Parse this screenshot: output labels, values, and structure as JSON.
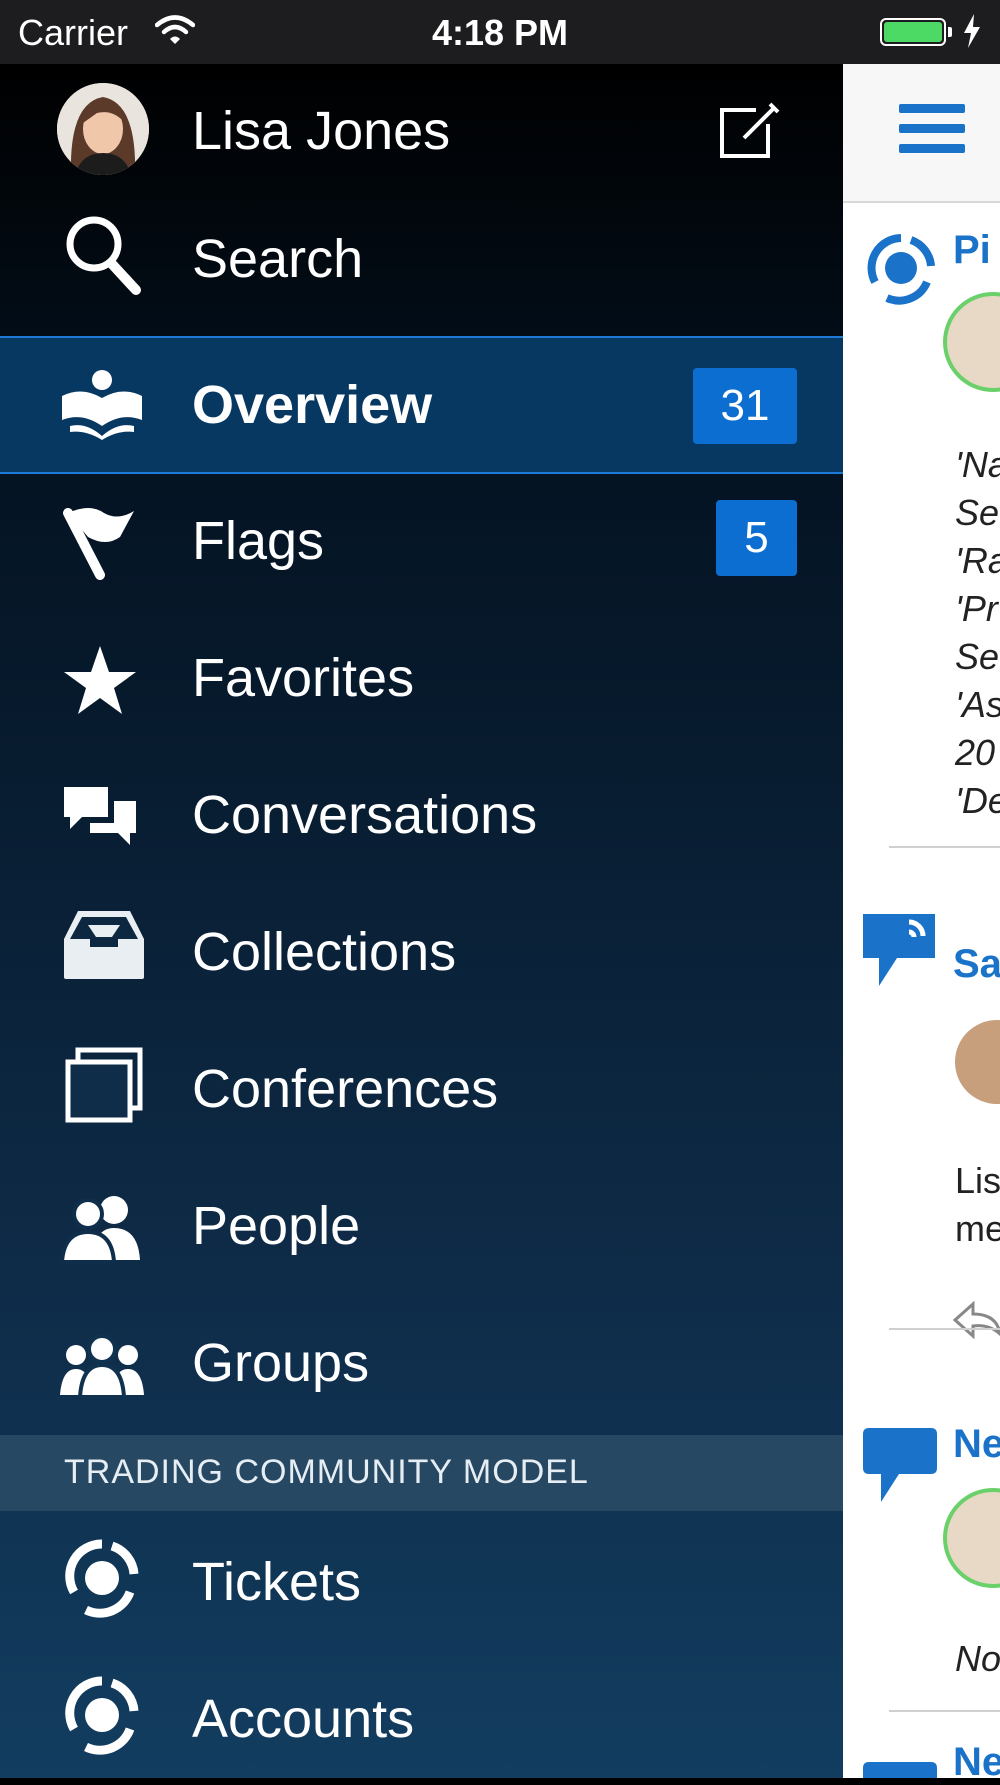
{
  "status_bar": {
    "carrier": "Carrier",
    "time": "4:18 PM",
    "battery_color": "#4cd964"
  },
  "drawer": {
    "user_name": "Lisa Jones",
    "search_label": "Search",
    "items": [
      {
        "label": "Overview",
        "icon": "overview-icon",
        "badge": "31",
        "selected": true
      },
      {
        "label": "Flags",
        "icon": "flag-icon",
        "badge": "5"
      },
      {
        "label": "Favorites",
        "icon": "star-icon"
      },
      {
        "label": "Conversations",
        "icon": "conversations-icon"
      },
      {
        "label": "Collections",
        "icon": "inbox-tray-icon"
      },
      {
        "label": "Conferences",
        "icon": "conferences-icon"
      },
      {
        "label": "People",
        "icon": "people-icon"
      },
      {
        "label": "Groups",
        "icon": "groups-icon"
      }
    ],
    "section_header": "TRADING COMMUNITY MODEL",
    "section_items": [
      {
        "label": "Tickets",
        "icon": "tickets-icon"
      },
      {
        "label": "Accounts",
        "icon": "accounts-icon"
      }
    ],
    "selected_color": "#073862",
    "badge_color": "#0d6ed1"
  },
  "content_peek": {
    "posts": [
      {
        "name_fragment": "Pi",
        "lines": [
          "'Na",
          "Se",
          "'Ra",
          "'Pr",
          "Se",
          "'As",
          "20",
          "'De"
        ]
      },
      {
        "name_fragment": "Sa",
        "lines": [
          "Lis",
          "me"
        ]
      },
      {
        "name_fragment": "Ne",
        "lines": [
          "No"
        ]
      },
      {
        "name_fragment": "Ne",
        "lines": []
      }
    ],
    "link_color": "#1a73c8"
  }
}
